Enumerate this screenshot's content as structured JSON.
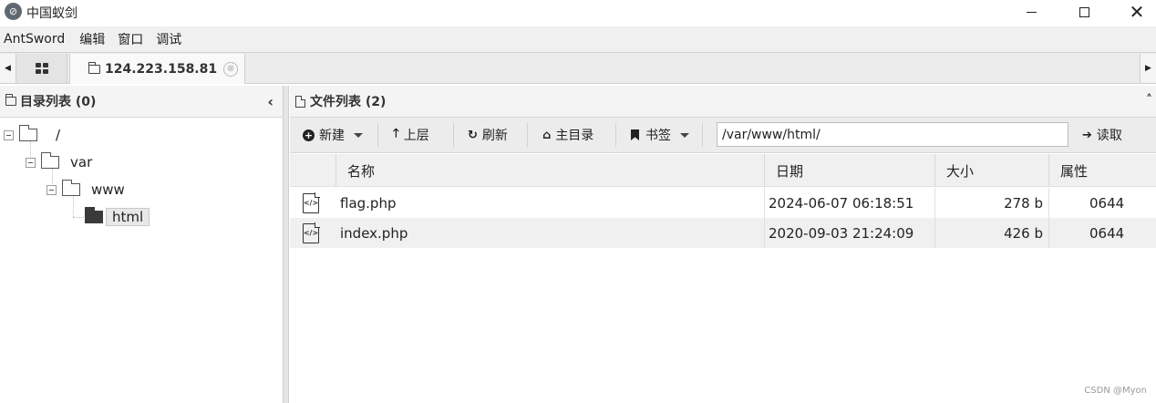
{
  "window": {
    "title": "中国蚁剑",
    "icon": "antsword-logo-icon"
  },
  "menu": {
    "items": [
      "AntSword",
      "编辑",
      "窗口",
      "调试"
    ]
  },
  "tabs": {
    "home_icon": "grid-icon",
    "active_tab": "124.223.158.81",
    "close_glyph": "⊗"
  },
  "left_panel": {
    "title": "目录列表 (0)",
    "collapse_glyph": "‹",
    "tree": [
      {
        "label": "/",
        "level": 0,
        "selected": false
      },
      {
        "label": "var",
        "level": 1,
        "selected": false
      },
      {
        "label": "www",
        "level": 2,
        "selected": false
      },
      {
        "label": "html",
        "level": 3,
        "selected": true
      }
    ]
  },
  "right_panel": {
    "title": "文件列表 (2)",
    "expand_glyph": "˄",
    "toolbar": {
      "new_label": "新建",
      "up_label": "上层",
      "refresh_label": "刷新",
      "home_label": "主目录",
      "bookmark_label": "书签",
      "read_label": "读取",
      "path_value": "/var/www/html/"
    },
    "columns": {
      "name": "名称",
      "date": "日期",
      "size": "大小",
      "attr": "属性"
    },
    "files": [
      {
        "name": "flag.php",
        "date": "2024-06-07 06:18:51",
        "size": "278 b",
        "attr": "0644"
      },
      {
        "name": "index.php",
        "date": "2020-09-03 21:24:09",
        "size": "426 b",
        "attr": "0644"
      }
    ]
  },
  "watermark": "CSDN @Myon⁠"
}
